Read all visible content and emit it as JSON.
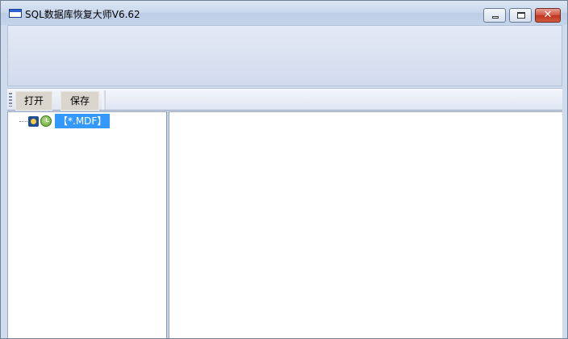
{
  "window": {
    "title": "SQL数据库恢复大师V6.62",
    "controls": {
      "minimize_icon": "minimize-icon",
      "maximize_icon": "maximize-icon",
      "close_icon": "close-icon",
      "close_glyph": "✕"
    }
  },
  "toolbar": {
    "open_label": "打开",
    "save_label": "保存"
  },
  "tree": {
    "nodes": [
      {
        "label": "【*.MDF】",
        "icons": [
          "database-icon",
          "clock-icon"
        ],
        "selected": true
      }
    ]
  },
  "colors": {
    "selection": "#3399ff",
    "close_button": "#c0341f",
    "chrome": "#cfdcee"
  }
}
